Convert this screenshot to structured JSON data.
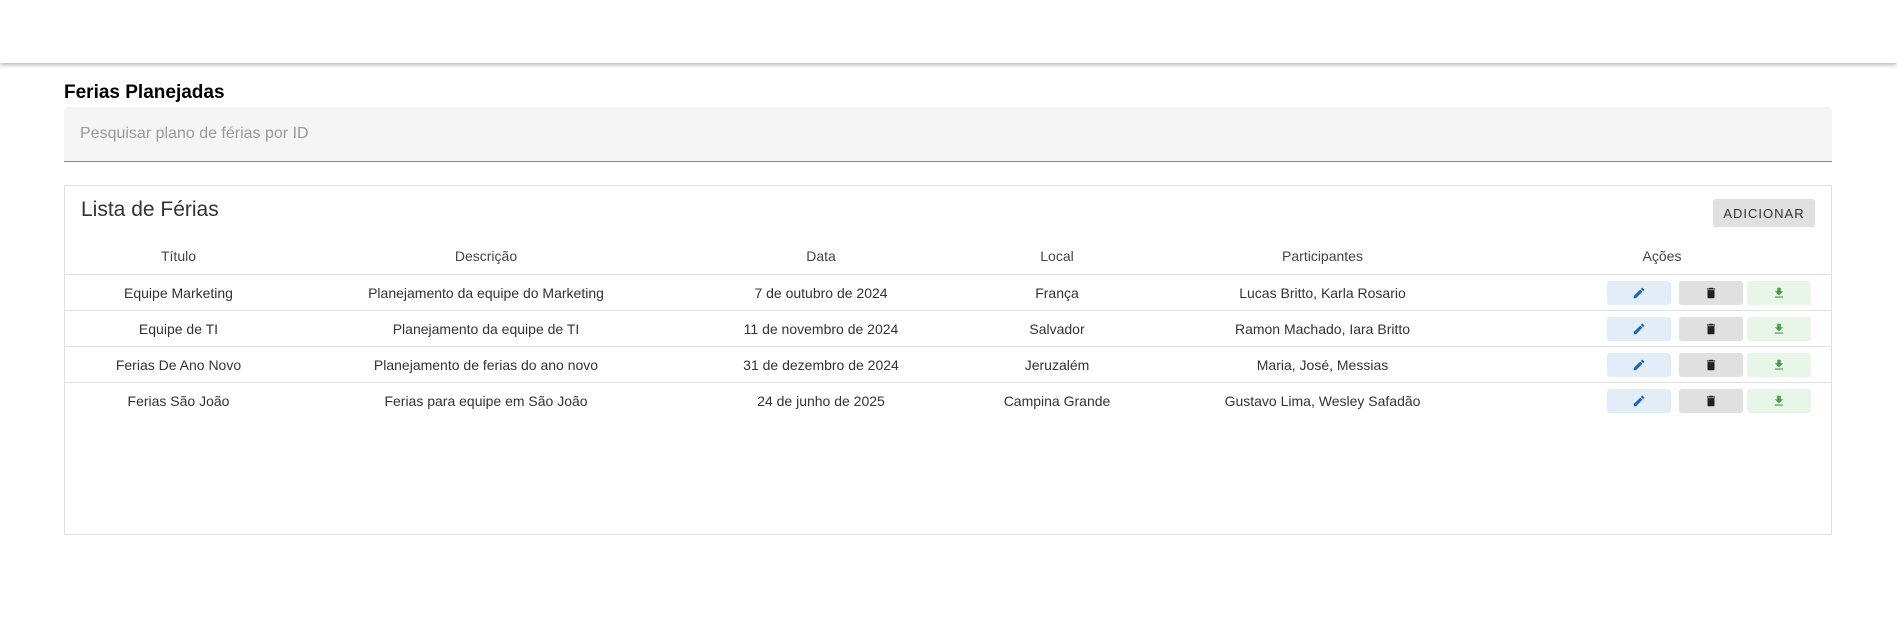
{
  "page": {
    "title": "Ferias Planejadas"
  },
  "search": {
    "placeholder": "Pesquisar plano de férias por ID",
    "value": ""
  },
  "card": {
    "title": "Lista de Férias",
    "add_label": "ADICIONAR"
  },
  "table": {
    "headers": {
      "titulo": "Título",
      "descricao": "Descrição",
      "data": "Data",
      "local": "Local",
      "participantes": "Participantes",
      "acoes": "Ações"
    },
    "rows": [
      {
        "titulo": "Equipe Marketing",
        "descricao": "Planejamento da equipe do Marketing",
        "data": "7 de outubro de 2024",
        "local": "França",
        "participantes": "Lucas Britto, Karla Rosario"
      },
      {
        "titulo": "Equipe de TI",
        "descricao": "Planejamento da equipe de TI",
        "data": "11 de novembro de 2024",
        "local": "Salvador",
        "participantes": "Ramon Machado, Iara Britto"
      },
      {
        "titulo": "Ferias De Ano Novo",
        "descricao": "Planejamento de ferias do ano novo",
        "data": "31 de dezembro de 2024",
        "local": "Jeruzalém",
        "participantes": "Maria, José, Messias"
      },
      {
        "titulo": "Ferias São João",
        "descricao": "Ferias para equipe em São João",
        "data": "24 de junho de 2025",
        "local": "Campina Grande",
        "participantes": "Gustavo Lima, Wesley Safadão"
      }
    ]
  },
  "icons": {
    "edit": "pencil-icon",
    "delete": "trash-icon",
    "download": "download-icon"
  },
  "colors": {
    "edit_icon": "#1565c0",
    "edit_bg": "#e3edf8",
    "delete_icon": "#212121",
    "delete_bg": "#e0e0e0",
    "download_icon": "#43a047",
    "download_bg": "#e8f5e9"
  }
}
